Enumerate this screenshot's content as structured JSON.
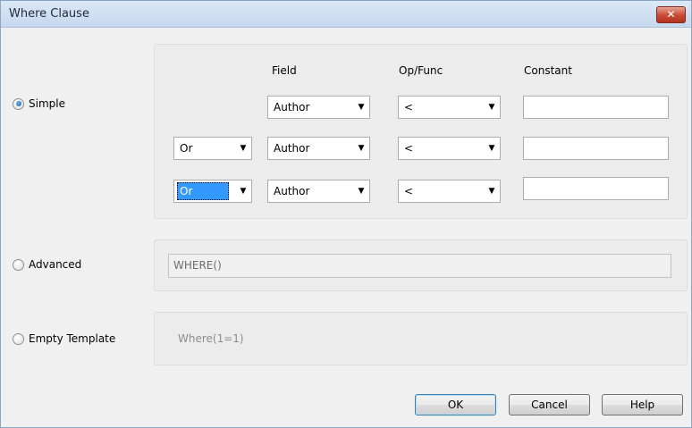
{
  "window": {
    "title": "Where Clause",
    "close_icon": "close-icon"
  },
  "simple": {
    "label": "Simple",
    "checked": true,
    "headers": {
      "field": "Field",
      "op": "Op/Func",
      "constant": "Constant"
    },
    "rows": [
      {
        "conjunction": null,
        "field": "Author",
        "op": "<",
        "constant": ""
      },
      {
        "conjunction": "Or",
        "field": "Author",
        "op": "<",
        "constant": ""
      },
      {
        "conjunction": "Or",
        "field": "Author",
        "op": "<",
        "constant": ""
      }
    ]
  },
  "advanced": {
    "label": "Advanced",
    "checked": false,
    "value": "WHERE()"
  },
  "empty_template": {
    "label": "Empty Template",
    "checked": false,
    "value": "Where(1=1)"
  },
  "buttons": {
    "ok": "OK",
    "cancel": "Cancel",
    "help": "Help"
  },
  "colors": {
    "selection": "#3399ff",
    "close_button": "#c74b34",
    "title_bar": "#c6d8ee"
  }
}
